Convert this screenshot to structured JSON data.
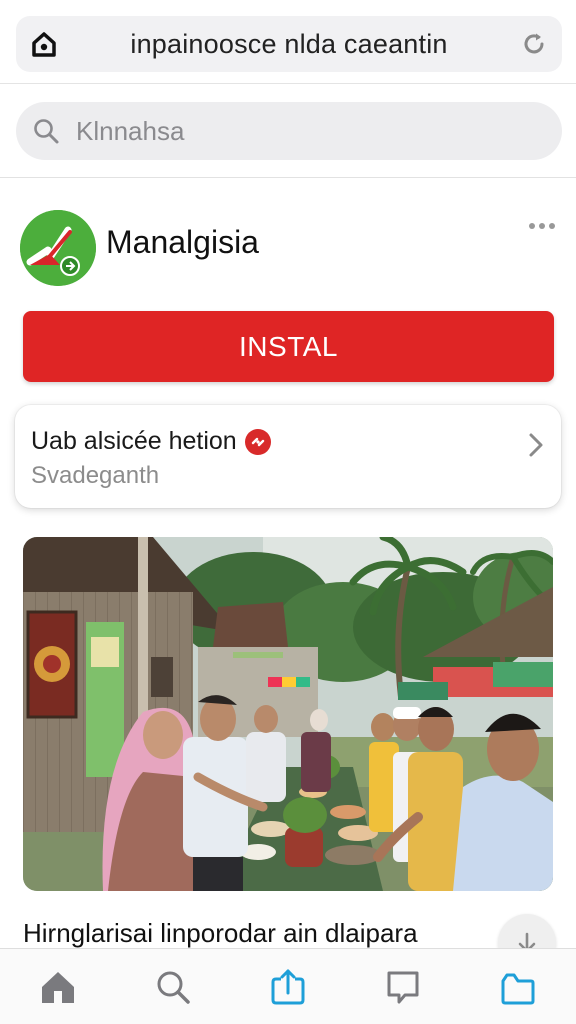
{
  "browser": {
    "url_text": "inpainoosce nlda caeantin",
    "lock_icon": "lock-icon",
    "reload_icon": "reload-icon"
  },
  "search": {
    "placeholder": "Klnnahsa",
    "icon": "search-icon"
  },
  "app": {
    "name": "Manalgisia",
    "logo_icon": "checkmark-logo-icon",
    "more_icon": "more-dots-icon",
    "install_label": "INSTAL"
  },
  "info_card": {
    "title": "Uab alsicée hetion",
    "subtitle": "Svadeganth",
    "badge_icon": "info-badge-icon",
    "chevron_icon": "chevron-right-icon"
  },
  "feature": {
    "image_subject": "market-gathering-photo",
    "headline": "Hirnglarisai linporodar ain dlaipara",
    "fab_icon": "arrow-down-icon"
  },
  "bottom_nav": {
    "items": [
      {
        "icon": "home-icon"
      },
      {
        "icon": "search-icon"
      },
      {
        "icon": "share-icon"
      },
      {
        "icon": "chat-icon"
      },
      {
        "icon": "folder-icon"
      }
    ]
  },
  "colors": {
    "accent_red": "#df2525",
    "logo_green": "#4cae3c",
    "nav_blue": "#1e9fd8"
  }
}
